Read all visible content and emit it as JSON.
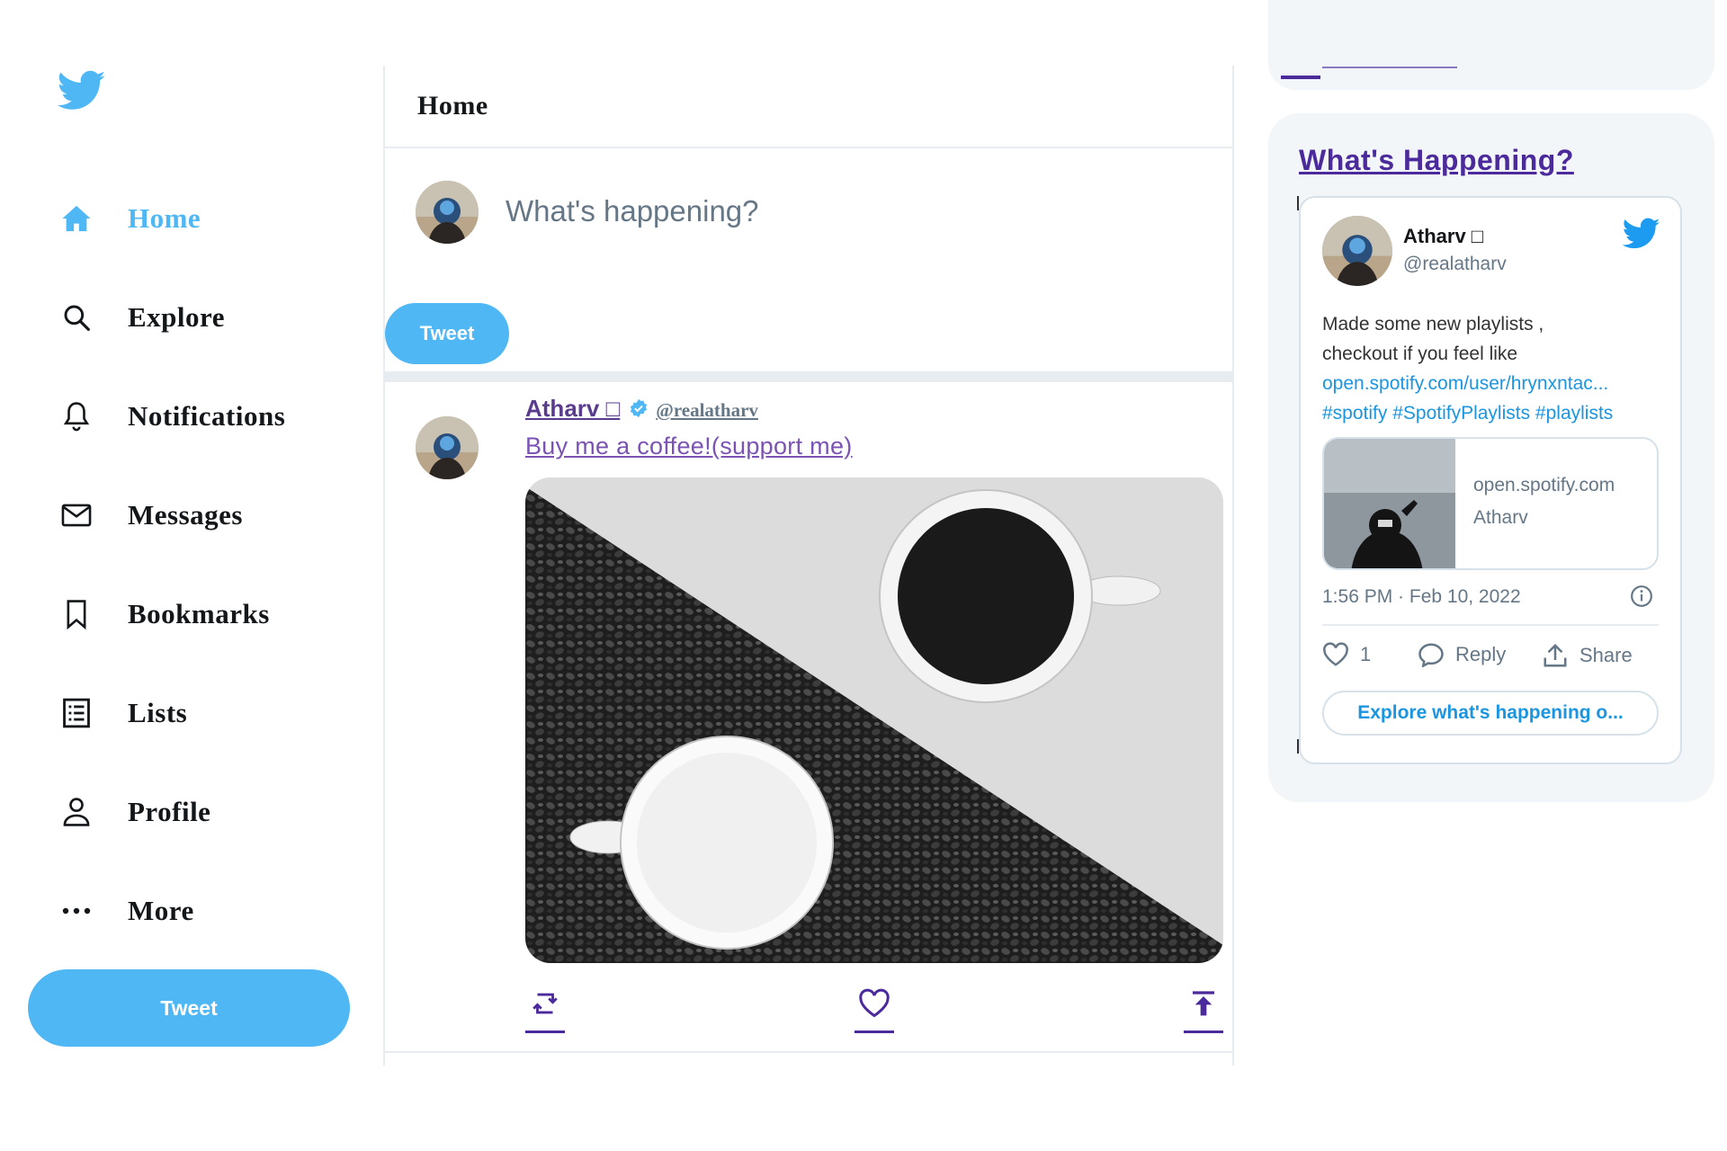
{
  "colors": {
    "accent": "#50b7f5",
    "link": "#1b95e0",
    "visited": "#4b2a9c",
    "border": "#e6ecf0"
  },
  "sidebar": {
    "logo_icon": "twitter-bird-icon",
    "items": [
      {
        "label": "Home",
        "icon": "home-icon",
        "active": true
      },
      {
        "label": "Explore",
        "icon": "search-icon"
      },
      {
        "label": "Notifications",
        "icon": "bell-icon"
      },
      {
        "label": "Messages",
        "icon": "mail-icon"
      },
      {
        "label": "Bookmarks",
        "icon": "bookmark-icon"
      },
      {
        "label": "Lists",
        "icon": "list-icon"
      },
      {
        "label": "Profile",
        "icon": "person-icon"
      },
      {
        "label": "More",
        "icon": "more-icon"
      }
    ],
    "tweet_button": "Tweet"
  },
  "feed": {
    "title": "Home",
    "composer": {
      "placeholder": "What's happening?",
      "tweet_button": "Tweet"
    },
    "post": {
      "name": "Atharv □",
      "handle": "@realatharv",
      "text": "Buy me a coffee!(support me)",
      "image_alt": "coffee-beans-and-cups-image",
      "actions": [
        "retweet-icon",
        "like-icon",
        "share-icon"
      ]
    }
  },
  "widget": {
    "title": "What's Happening?",
    "card": {
      "name": "Atharv □",
      "handle": "@realatharv",
      "text_line1": "Made some new playlists ,",
      "text_line2": "checkout if you feel like",
      "link": "open.spotify.com/user/hrynxntac...",
      "hashtags": "#spotify #SpotifyPlaylists #playlists",
      "link_card": {
        "domain": "open.spotify.com",
        "title": "Atharv"
      },
      "timestamp": "1:56 PM · Feb 10, 2022",
      "like_count": "1",
      "reply_label": "Reply",
      "share_label": "Share",
      "explore_button": "Explore what's happening o..."
    }
  }
}
